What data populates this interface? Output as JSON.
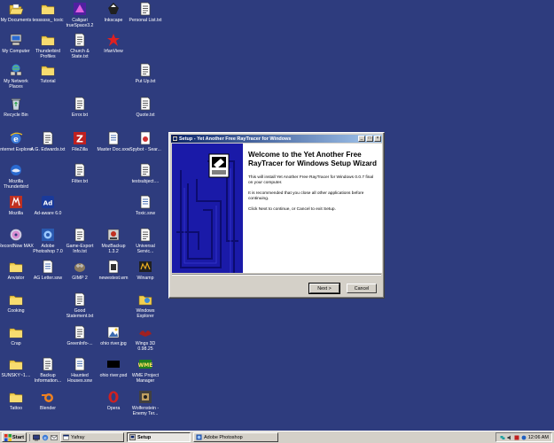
{
  "desktop_icons": [
    {
      "label": "My Documents",
      "icon": "folder-open-icon"
    },
    {
      "label": "tessssss_ toxic",
      "icon": "folder-icon"
    },
    {
      "label": "Caligari trueSpace3.2",
      "icon": "truespace-icon"
    },
    {
      "label": "Inkscape",
      "icon": "inkscape-icon"
    },
    {
      "label": "Personal List.txt",
      "icon": "text-file-icon"
    },
    {
      "label": "My Computer",
      "icon": "computer-icon"
    },
    {
      "label": "Thunderbird Profiles",
      "icon": "folder-icon"
    },
    {
      "label": "Church & State.txt",
      "icon": "text-file-icon"
    },
    {
      "label": "IrfanView",
      "icon": "irfanview-icon"
    },
    {
      "label": "My Network Places",
      "icon": "network-icon"
    },
    {
      "label": "Tutorial",
      "icon": "folder-icon"
    },
    {
      "label": "Put Up.txt",
      "icon": "text-file-icon"
    },
    {
      "label": "Recycle Bin",
      "icon": "recycle-bin-icon"
    },
    {
      "label": "Error.txt",
      "icon": "text-file-icon"
    },
    {
      "label": "Quote.txt",
      "icon": "text-file-icon"
    },
    {
      "label": "Internet Explorer",
      "icon": "ie-icon"
    },
    {
      "label": "A.G. Edwards.txt",
      "icon": "text-file-icon"
    },
    {
      "label": "FileZilla",
      "icon": "filezilla-icon"
    },
    {
      "label": "Master Doc.sxw",
      "icon": "writer-doc-icon"
    },
    {
      "label": "Spybot - Sear...",
      "icon": "spybot-icon"
    },
    {
      "label": "Mozilla Thunderbird",
      "icon": "thunderbird-icon"
    },
    {
      "label": "Filter.txt",
      "icon": "text-file-icon"
    },
    {
      "label": "testsubject....",
      "icon": "text-file-icon"
    },
    {
      "label": "Mozilla",
      "icon": "mozilla-icon"
    },
    {
      "label": "Ad-aware 6.0",
      "icon": "adaware-icon"
    },
    {
      "label": "Toxic.sxw",
      "icon": "writer-doc-icon"
    },
    {
      "label": "RecordNow MAX",
      "icon": "cd-icon"
    },
    {
      "label": "Adobe Photoshop 7.0",
      "icon": "photoshop-icon"
    },
    {
      "label": "Game-Export Info.txt",
      "icon": "text-file-icon"
    },
    {
      "label": "MozBackup 1.3.2",
      "icon": "mozbackup-icon"
    },
    {
      "label": "Universal Servic...",
      "icon": "text-file-icon"
    },
    {
      "label": "Anvistor",
      "icon": "folder-icon"
    },
    {
      "label": "AG Letter.sxw",
      "icon": "writer-doc-icon"
    },
    {
      "label": "GIMP 2",
      "icon": "gimp-icon"
    },
    {
      "label": "newestest.wm",
      "icon": "wm-file-icon"
    },
    {
      "label": "Winamp",
      "icon": "winamp-icon"
    },
    {
      "label": "Cooking",
      "icon": "folder-icon"
    },
    {
      "label": "Good Statement.txt",
      "icon": "text-file-icon"
    },
    {
      "label": "Windows Explorer",
      "icon": "explorer-icon"
    },
    {
      "label": "Crap",
      "icon": "folder-icon"
    },
    {
      "label": "GreenInfo-...",
      "icon": "text-file-icon"
    },
    {
      "label": "ohio river.jpg",
      "icon": "image-file-icon"
    },
    {
      "label": "Wings 3D 0.98.25",
      "icon": "wings3d-icon"
    },
    {
      "label": "SUNSKY~1....",
      "icon": "folder-icon"
    },
    {
      "label": "Backup Information...",
      "icon": "text-file-icon"
    },
    {
      "label": "Haunted Houses.sxw",
      "icon": "writer-doc-icon"
    },
    {
      "label": "ohio river.psd",
      "icon": "psd-file-icon"
    },
    {
      "label": "WME Project Manager",
      "icon": "wme-icon"
    },
    {
      "label": "Tattoo",
      "icon": "folder-icon"
    },
    {
      "label": "Blender",
      "icon": "blender-icon"
    },
    {
      "label": "Opera",
      "icon": "opera-icon"
    },
    {
      "label": "Wolfenstein - Enemy Ter...",
      "icon": "wolfenstein-icon"
    }
  ],
  "window": {
    "title": "Setup - Yet Another Free RayTracer for Windows",
    "heading": "Welcome to the Yet Another Free RayTracer for Windows Setup Wizard",
    "paragraphs": [
      "This will install Yet Another Free RayTracer for Windows 0.0.7 final on your computer.",
      "It is recommended that you close all other applications before continuing.",
      "Click Next to continue, or Cancel to exit Setup."
    ],
    "next_label": "Next >",
    "cancel_label": "Cancel",
    "minimize_label": "_",
    "maximize_label": "□",
    "close_label": "×"
  },
  "taskbar": {
    "start_label": "Start",
    "tasks": [
      {
        "label": "Yafray",
        "active": false
      },
      {
        "label": "Setup",
        "active": true
      },
      {
        "label": "Adobe Photoshop",
        "active": false
      }
    ],
    "clock": "12:06 AM"
  },
  "colors": {
    "desktop": "#2e3c7e",
    "title_start": "#0a246a",
    "title_end": "#a6caf0",
    "wizard_sidebar": "#1a1aa8"
  }
}
